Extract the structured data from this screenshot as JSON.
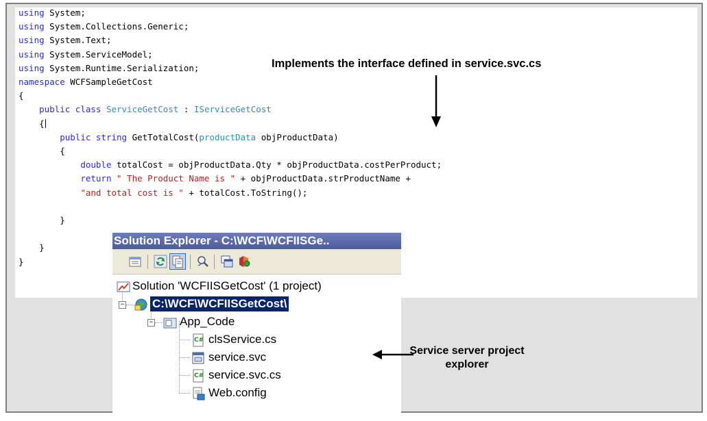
{
  "code": {
    "lines": [
      [
        {
          "t": "using",
          "c": "kw"
        },
        {
          "t": " System;"
        }
      ],
      [
        {
          "t": "using",
          "c": "kw"
        },
        {
          "t": " System.Collections.Generic;"
        }
      ],
      [
        {
          "t": "using",
          "c": "kw"
        },
        {
          "t": " System.Text;"
        }
      ],
      [
        {
          "t": "using",
          "c": "kw"
        },
        {
          "t": " System.ServiceModel;"
        }
      ],
      [
        {
          "t": "using",
          "c": "kw"
        },
        {
          "t": " System.Runtime.Serialization;"
        }
      ],
      [
        {
          "t": "namespace",
          "c": "kw"
        },
        {
          "t": " WCFSampleGetCost"
        }
      ],
      [
        {
          "t": "{"
        }
      ],
      [
        {
          "t": "    "
        },
        {
          "t": "public",
          "c": "kw"
        },
        {
          "t": " "
        },
        {
          "t": "class",
          "c": "kw"
        },
        {
          "t": " "
        },
        {
          "t": "ServiceGetCost",
          "c": "ty"
        },
        {
          "t": " : "
        },
        {
          "t": "IServiceGetCost",
          "c": "ty"
        }
      ],
      [
        {
          "t": "    {"
        },
        {
          "caret": true
        }
      ],
      [
        {
          "t": "        "
        },
        {
          "t": "public",
          "c": "kw"
        },
        {
          "t": " "
        },
        {
          "t": "string",
          "c": "kw"
        },
        {
          "t": " GetTotalCost("
        },
        {
          "t": "productData",
          "c": "ty"
        },
        {
          "t": " objProductData)"
        }
      ],
      [
        {
          "t": "        {"
        }
      ],
      [
        {
          "t": "            "
        },
        {
          "t": "double",
          "c": "kw"
        },
        {
          "t": " totalCost = objProductData.Qty * objProductData.costPerProduct;"
        }
      ],
      [
        {
          "t": "            "
        },
        {
          "t": "return",
          "c": "kw"
        },
        {
          "t": " "
        },
        {
          "t": "\" The Product Name is \"",
          "c": "str"
        },
        {
          "t": " + objProductData.strProductName +"
        }
      ],
      [
        {
          "t": "            "
        },
        {
          "t": "\"and total cost is \"",
          "c": "str"
        },
        {
          "t": " + totalCost.ToString();"
        }
      ],
      [
        {
          "t": ""
        }
      ],
      [
        {
          "t": "        }"
        }
      ],
      [
        {
          "t": ""
        }
      ],
      [
        {
          "t": "    }"
        }
      ],
      [
        {
          "t": "}"
        }
      ]
    ]
  },
  "annotations": {
    "top": "Implements the interface defined in service.svc.cs",
    "bottom": "Service server project explorer"
  },
  "explorer": {
    "title": "Solution Explorer - C:\\WCF\\WCFIISGe..",
    "toolbar": [
      "properties-icon",
      "refresh-icon",
      "show-all-files-icon",
      "view-code-icon",
      "view-designer-icon",
      "wcf-config-icon"
    ],
    "solution_label": "Solution 'WCFIISGetCost' (1 project)",
    "project_label": "C:\\WCF\\WCFIISGetCost\\",
    "folder_label": "App_Code",
    "files": [
      "clsService.cs",
      "service.svc",
      "service.svc.cs",
      "Web.config"
    ]
  },
  "colors": {
    "keyword": "#2b2bd4",
    "type": "#2f8fb0",
    "string": "#b22222",
    "title_bar": "#4d5c9e",
    "selection": "#0a246a",
    "frame_bg": "#e1e1e1"
  }
}
